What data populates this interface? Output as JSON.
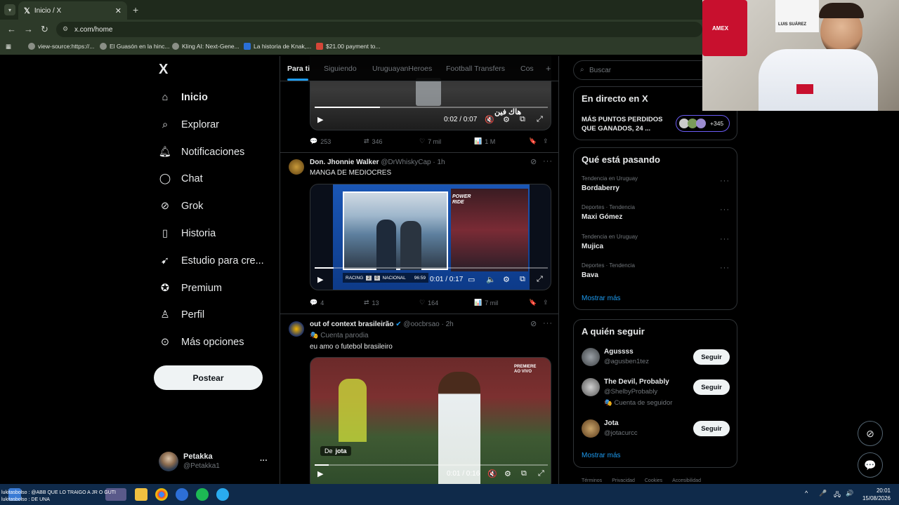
{
  "browser": {
    "tab_title": "Inicio / X",
    "new_tab": "+",
    "url": "x.com/home",
    "bookmarks": [
      "view-source:https://...",
      "El Guasón en la hinc...",
      "Kling AI: Next-Gene...",
      "La historia de Knak,...",
      "$21.00 payment to..."
    ]
  },
  "sidebar": {
    "logo": "X",
    "items": [
      {
        "label": "Inicio",
        "icon": "home-icon"
      },
      {
        "label": "Explorar",
        "icon": "search-icon"
      },
      {
        "label": "Notificaciones",
        "icon": "bell-icon"
      },
      {
        "label": "Chat",
        "icon": "chat-icon"
      },
      {
        "label": "Grok",
        "icon": "grok-icon"
      },
      {
        "label": "Historia",
        "icon": "bookmark-icon"
      },
      {
        "label": "Estudio para cre...",
        "icon": "rocket-icon"
      },
      {
        "label": "Premium",
        "icon": "verified-icon"
      },
      {
        "label": "Perfil",
        "icon": "person-icon"
      },
      {
        "label": "Más opciones",
        "icon": "more-circle-icon"
      }
    ],
    "post_button": "Postear",
    "account": {
      "name": "Petakka",
      "handle": "@Petakka1",
      "more": "···"
    }
  },
  "feed_tabs": [
    "Para ti",
    "Siguiendo",
    "UruguayanHeroes",
    "Football Transfers",
    "Cos"
  ],
  "feed_tabs_add": "+",
  "tweets": [
    {
      "overlay_text": "هاك فين",
      "video_time": "0:02 / 0:07",
      "video_progress": 0.28,
      "stats": {
        "replies": "253",
        "reposts": "346",
        "likes": "7 mil",
        "views": "1 M"
      }
    },
    {
      "name": "Don. Jhonnie Walker",
      "handle": "@DrWhiskyCap · 1h",
      "text": "MANGA DE MEDIOCRES",
      "scoreboard": {
        "team_a": "RACING",
        "score_a": "2",
        "score_b": "0",
        "team_b": "NACIONAL",
        "minute": "96:59"
      },
      "side_label": "POWER RIDE",
      "video_time": "0:01 / 0:17",
      "video_progress": 0.08,
      "stats": {
        "replies": "4",
        "reposts": "13",
        "likes": "164",
        "views": "7 mil"
      }
    },
    {
      "name": "out of context brasileirão",
      "handle": "@oocbrsao · 2h",
      "parody": "Cuenta parodia",
      "text": "eu amo o futebol brasileiro",
      "broadcast_tag": "PREMIERE AO VIVO",
      "from_label": "De",
      "from_user": "jota",
      "video_time": "0:01 / 0:16",
      "video_progress": 0.06
    }
  ],
  "right": {
    "search_placeholder": "Buscar",
    "live": {
      "title": "En directo en X",
      "headline": "MÁS PUNTOS PERDIDOS QUE GANADOS, 24 ...",
      "count": "+345"
    },
    "trends_title": "Qué está pasando",
    "trends": [
      {
        "meta": "Tendencia en Uruguay",
        "name": "Bordaberry"
      },
      {
        "meta": "Deportes · Tendencia",
        "name": "Maxi Gómez"
      },
      {
        "meta": "Tendencia en Uruguay",
        "name": "Mujica"
      },
      {
        "meta": "Deportes · Tendencia",
        "name": "Bava"
      }
    ],
    "show_more": "Mostrar más",
    "follow_title": "A quién seguir",
    "follow": [
      {
        "name": "Agussss",
        "handle": "@agusben1tez",
        "button": "Seguir"
      },
      {
        "name": "The Devil, Probably",
        "handle": "@ShelbyProbably",
        "sub": "Cuenta de seguidor",
        "button": "Seguir"
      },
      {
        "name": "Jota",
        "handle": "@jotacurcc",
        "button": "Seguir"
      }
    ],
    "footer": [
      "Términos",
      "Privacidad",
      "Cookies",
      "Accesibilidad"
    ]
  },
  "webcam": {
    "jersey_text": "LUIS SUÁREZ",
    "shirt_sponsor": "AMEX"
  },
  "chat_overlay": [
    "lukitasbolso : @ABB QUE LO TRAIGO A JR O GUTI",
    "lukitasbolso : DE UNA"
  ],
  "taskbar": {
    "time": "20:01",
    "date": "15/08/2026"
  },
  "colors": {
    "accent": "#1d9bf0",
    "border": "#2f3336",
    "muted": "#71767b",
    "text": "#e7e9ea",
    "taskbar": "#0f2a4a"
  }
}
